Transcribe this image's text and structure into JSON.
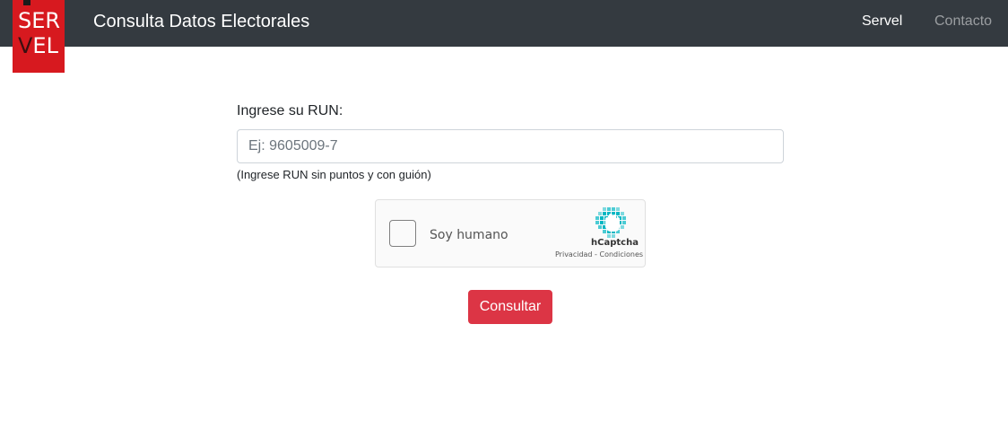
{
  "header": {
    "logo_line1": "SER",
    "logo_line2_v": "V",
    "logo_line2_rest": "EL",
    "brand_title": "Consulta Datos Electorales",
    "nav": [
      {
        "label": "Servel"
      },
      {
        "label": "Contacto"
      }
    ]
  },
  "form": {
    "run_label": "Ingrese su RUN:",
    "run_placeholder": "Ej: 9605009-7",
    "run_value": "",
    "run_help": "(Ingrese RUN sin puntos y con guión)",
    "captcha": {
      "label": "Soy humano",
      "brand": "hCaptcha",
      "link_privacy": "Privacidad",
      "link_separator": " - ",
      "link_terms": "Condiciones",
      "checked": false
    },
    "submit_label": "Consultar"
  },
  "colors": {
    "navbar_bg": "#343a40",
    "logo_red": "#d7191f",
    "button_red": "#dc3545",
    "hcaptcha_teal": "#00b7c3"
  }
}
